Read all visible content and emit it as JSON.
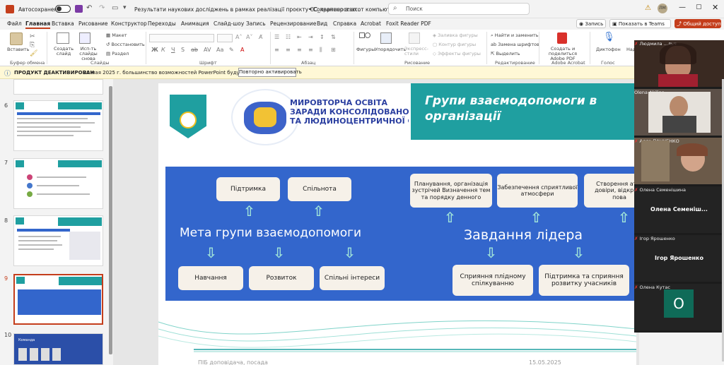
{
  "titlebar": {
    "autosave": "Автосохранение",
    "doc_title": "Результати наукових досліджень в рамках реалізації проєкту ЄС_партнерство...",
    "saved": "• Сохранено в: этот компьютер",
    "search": "Поиск",
    "user_initials": "ЛМ"
  },
  "menu": [
    "Файл",
    "Главная",
    "Вставка",
    "Рисование",
    "Конструктор",
    "Переходы",
    "Анимация",
    "Слайд-шоу",
    "Запись",
    "Рецензирование",
    "Вид",
    "Справка",
    "Acrobat",
    "Foxit Reader PDF"
  ],
  "menu_right": {
    "record": "Запись",
    "teams": "Показать в Teams",
    "share": "Общий доступ"
  },
  "ribbon": {
    "paste": "Вставить",
    "create_slide": "Создать слайд",
    "reuse": "Исп-ть слайды снова",
    "layout": "Макет",
    "reset": "Восстановить",
    "section": "Раздел",
    "groups": [
      "Буфер обмена",
      "Слайды",
      "Шрифт",
      "Абзац",
      "Рисование",
      "Редактирование",
      "Adobe Acrobat",
      "Голос"
    ],
    "figures": "Фигуры",
    "arrange": "Упорядочить",
    "express": "Экспресс-стили",
    "fill": "Заливка фигуры",
    "outline": "Контур фигуры",
    "effects": "Эффекты фигуры",
    "find": "Найти и заменить",
    "replace_fonts": "Замена шрифтов",
    "select": "Выделить",
    "acrobat": "Создать и поделиться Adobe PDF",
    "dictation": "Диктофон",
    "des": "Над"
  },
  "notification": {
    "title": "ПРОДУКТ ДЕАКТИВИРОВАН",
    "message": "20 мая 2025 г. большинство возможностей PowerPoint будут отключены.",
    "button": "Повторно активировать"
  },
  "thumbs": {
    "numbers": [
      "6",
      "7",
      "8",
      "9",
      "10"
    ],
    "t10_title": "Команда"
  },
  "slide": {
    "org_name_1": "МИРОВТОРЧА ОСВІТА",
    "org_name_2": "ЗАРАДИ КОНСОЛІДОВАНОЇ",
    "org_name_3": "ТА ЛЮДИНОЦЕНТРИЧНОЇ ЄВРОПИ",
    "title": "Групи взаємодопомоги в організації",
    "left_heading": "Мета групи взаємодопомоги",
    "right_heading": "Завдання лідера",
    "left_top": [
      "Підтримка",
      "Спільнота"
    ],
    "left_bottom": [
      "Навчання",
      "Розвиток",
      "Спільні інтереси"
    ],
    "right_top": [
      "Планування, організація зустрічей Визначення тем та порядку денного",
      "Забезпечення сприятливої атмосфери",
      "Створення атм. довіри, відкр. та пова"
    ],
    "right_bottom": [
      "Сприяння плідному спілкуванню",
      "Підтримка та сприяння розвитку учасників"
    ],
    "footer_left": "ПІБ доповідача, посада",
    "footer_right": "15.05.2025"
  },
  "video": {
    "tiles": [
      {
        "name": "Людмила ...льч",
        "type": "video"
      },
      {
        "name": "Olena Akilina",
        "type": "video"
      },
      {
        "name": "Алла ПАНЧЕНКО",
        "type": "video"
      },
      {
        "name": "Олена Семенішина",
        "type": "name",
        "big": "Олена Семеніш..."
      },
      {
        "name": "Ігор Ярошенко",
        "type": "name",
        "big": "Ігор Ярошенко"
      },
      {
        "name": "Олена Кутас",
        "type": "avatar",
        "letter": "О"
      }
    ]
  },
  "colors": {
    "accent": "#c43e1c",
    "teal": "#1f9fa0",
    "blue": "#3366cc",
    "notif": "#fff8d6"
  }
}
